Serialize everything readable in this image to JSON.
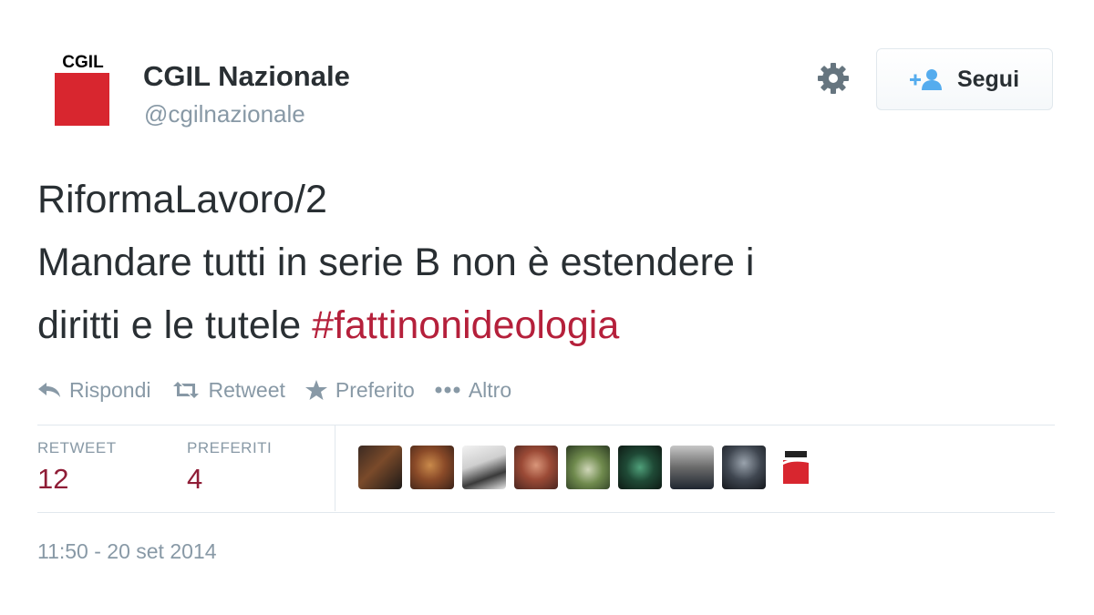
{
  "user": {
    "display_name": "CGIL Nazionale",
    "handle": "@cgilnazionale",
    "avatar_logo_text": "CGIL"
  },
  "follow_button": {
    "label": "Segui"
  },
  "tweet": {
    "lines": [
      "RiformaLavoro/2",
      "Mandare tutti in serie B non è estendere i",
      "diritti e le tutele "
    ],
    "hashtag": "#fattinonideologia",
    "timestamp": "11:50 - 20 set 2014"
  },
  "actions": {
    "reply": "Rispondi",
    "retweet": "Retweet",
    "favorite": "Preferito",
    "more": "Altro"
  },
  "stats": {
    "retweets_label": "RETWEET",
    "retweets_value": "12",
    "favorites_label": "PREFERITI",
    "favorites_value": "4"
  },
  "colors": {
    "brand_red": "#d8262f",
    "hashtag": "#b5203b",
    "stat_value": "#8f1d36",
    "muted": "#8899a6"
  },
  "favorited_by_avatars": [
    "user-avatar-1",
    "user-avatar-2",
    "user-avatar-3",
    "user-avatar-4",
    "user-avatar-5",
    "user-avatar-6",
    "user-avatar-7",
    "user-avatar-8",
    "cgil-avatar"
  ]
}
